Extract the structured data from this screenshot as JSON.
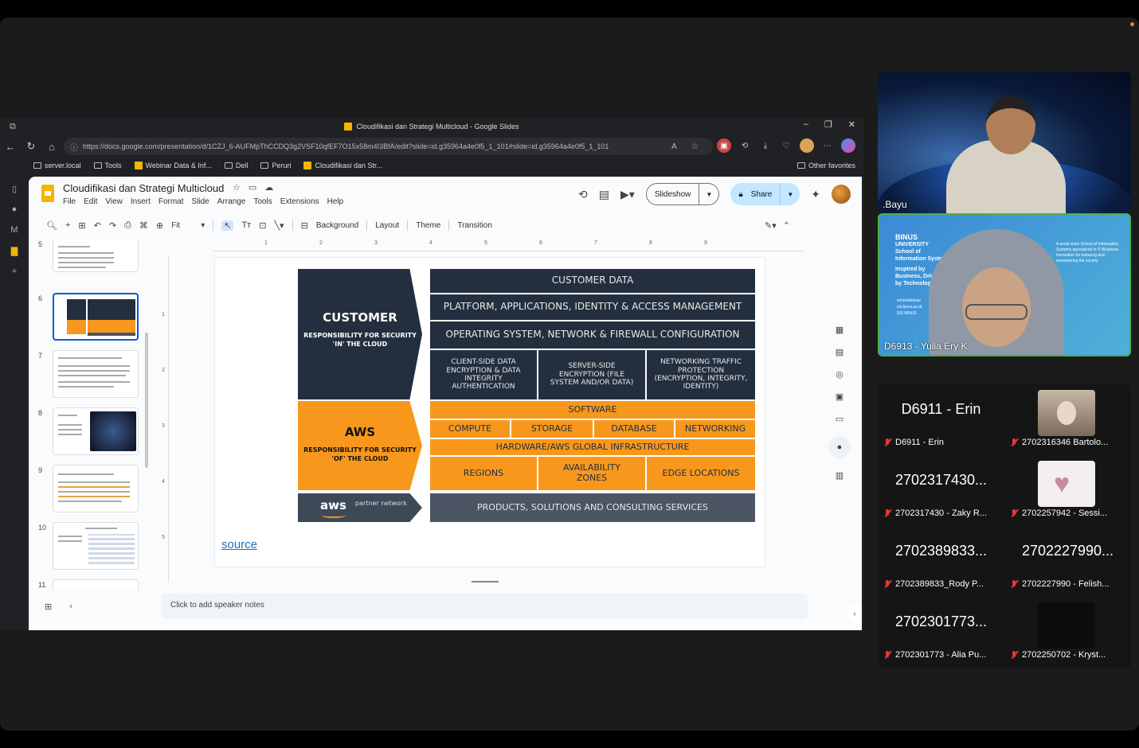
{
  "browser": {
    "tab_title": "Cloudifikasi dan Strategi Multicloud - Google Slides",
    "url": "https://docs.google.com/presentation/d/1CZJ_6-AUFMpThCCDQ3g2VSF10qfEF7O15x58m4I3BfA/edit?slide=id.g35964a4e0f5_1_101#slide=id.g35964a4e0f5_1_101",
    "bookmarks": [
      "server.local",
      "Tools",
      "Webinar Data & Inf...",
      "Dell",
      "Peruri",
      "Cloudifikasi dan Str..."
    ],
    "other_favorites": "Other favorites"
  },
  "slides_app": {
    "doc_title": "Cloudifikasi dan Strategi Multicloud",
    "menu": [
      "File",
      "Edit",
      "View",
      "Insert",
      "Format",
      "Slide",
      "Arrange",
      "Tools",
      "Extensions",
      "Help"
    ],
    "slideshow_label": "Slideshow",
    "share_label": "Share",
    "toolbar": {
      "zoom": "Fit",
      "background": "Background",
      "layout": "Layout",
      "theme": "Theme",
      "transition": "Transition"
    },
    "ruler_h": [
      "1",
      "2",
      "3",
      "4",
      "5",
      "6",
      "7",
      "8",
      "9"
    ],
    "ruler_v": [
      "1",
      "2",
      "3",
      "4",
      "5"
    ],
    "thumbnails": [
      {
        "num": "5",
        "caption": "Security Concerns"
      },
      {
        "num": "6",
        "caption": ""
      },
      {
        "num": "7",
        "caption": "Overcoming Cloud Security & Availability: Key Tactics"
      },
      {
        "num": "8",
        "caption": "Multi Cloud Strategy"
      },
      {
        "num": "9",
        "caption": ""
      },
      {
        "num": "10",
        "caption": ""
      },
      {
        "num": "11",
        "caption": ""
      }
    ],
    "notes_placeholder": "Click to add speaker notes",
    "slide": {
      "customer_title": "CUSTOMER",
      "customer_sub": "RESPONSIBILITY FOR SECURITY 'IN' THE CLOUD",
      "aws_title": "AWS",
      "aws_sub": "RESPONSIBILITY FOR SECURITY 'OF' THE CLOUD",
      "apn_logo": "aws",
      "apn_text": "partner network",
      "customer_data": "CUSTOMER DATA",
      "platform": "PLATFORM, APPLICATIONS, IDENTITY & ACCESS MANAGEMENT",
      "os": "OPERATING SYSTEM, NETWORK & FIREWALL CONFIGURATION",
      "client_side": "CLIENT-SIDE DATA ENCRYPTION & DATA INTEGRITY AUTHENTICATION",
      "server_side": "SERVER-SIDE ENCRYPTION (FILE SYSTEM AND/OR DATA)",
      "networking_traffic": "NETWORKING TRAFFIC PROTECTION (ENCRYPTION, INTEGRITY, IDENTITY)",
      "software": "SOFTWARE",
      "compute": "COMPUTE",
      "storage": "STORAGE",
      "database": "DATABASE",
      "networking": "NETWORKING",
      "hardware": "HARDWARE/AWS GLOBAL INFRASTRUCTURE",
      "regions": "REGIONS",
      "availability_zones": "AVAILABILITY ZONES",
      "edge_locations": "EDGE LOCATIONS",
      "products": "PRODUCTS, SOLUTIONS AND CONSULTING SERVICES",
      "source_link": "source"
    }
  },
  "meeting": {
    "speaker": {
      "name": ".Bayu"
    },
    "pinned": {
      "name": "D6913 - Yulia Ery K"
    },
    "binus": {
      "brand": "BINUS",
      "line1": "UNIVERSITY",
      "line2": "School of",
      "line3": "Information Systems",
      "tagline": "Inspired by Business, Driven by Technology.",
      "right_text": "A world class School of Information Systems specialized in IT-Business Innovation for fostering and empowering the society",
      "links": [
        "schoolisbinus",
        "sis.binus.ac.id",
        "SIS BINUS"
      ]
    },
    "participants": [
      {
        "tile": "D6911 - Erin",
        "label": "D6911 - Erin",
        "has_video": false
      },
      {
        "tile": "",
        "label": "2702316346 Bartolo...",
        "has_video": true,
        "img": "photo"
      },
      {
        "tile": "2702317430...",
        "label": "2702317430 - Zaky R...",
        "has_video": false
      },
      {
        "tile": "",
        "label": "2702257942 - Sessi...",
        "has_video": true,
        "img": "heart"
      },
      {
        "tile": "2702389833...",
        "label": "2702389833_Rody P...",
        "has_video": false
      },
      {
        "tile": "2702227990...",
        "label": "2702227990 - Felish...",
        "has_video": false
      },
      {
        "tile": "2702301773...",
        "label": "2702301773 - Alia Pu...",
        "has_video": false
      },
      {
        "tile": "",
        "label": "2702250702 - Kryst...",
        "has_video": true,
        "img": "dark"
      }
    ],
    "accent": "#4caf50"
  }
}
